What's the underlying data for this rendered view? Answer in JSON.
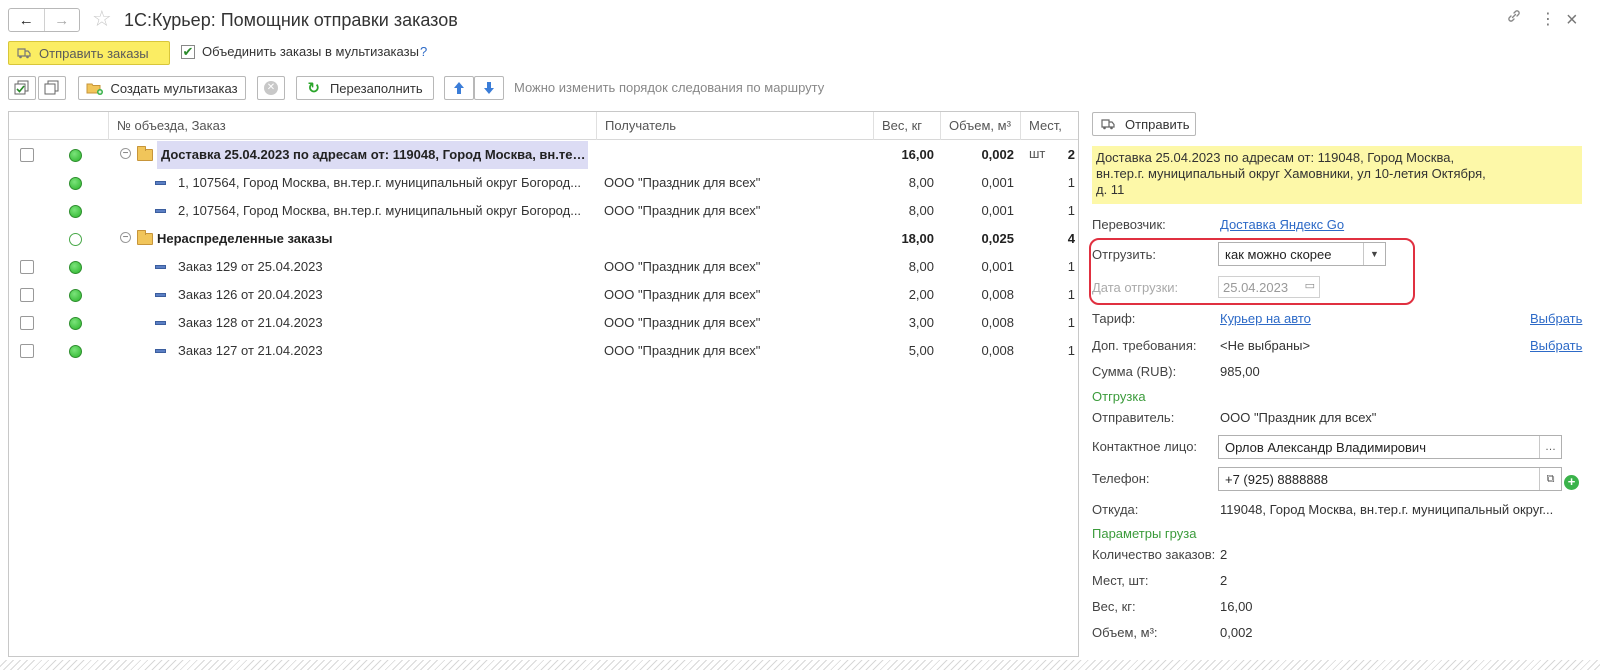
{
  "window": {
    "title": "1С:Курьер: Помощник отправки заказов",
    "back_glyph": "←",
    "forward_glyph": "→",
    "star_glyph": "☆",
    "link_glyph": "🔗",
    "menu_glyph": "⋮",
    "close_glyph": "×"
  },
  "toolbar1": {
    "send_orders_label": "Отправить заказы",
    "merge_checkbox_label": "Объединить заказы в мультизаказы",
    "merge_checked": true,
    "help": "?"
  },
  "toolbar2": {
    "create_multiorder_label": "Создать мультизаказ",
    "refill_label": "Перезаполнить",
    "hint": "Можно изменить порядок следования по маршруту"
  },
  "table": {
    "columns": [
      "№ объезда, Заказ",
      "Получатель",
      "Вес, кг",
      "Объем, м³",
      "Мест, шт"
    ],
    "rows": [
      {
        "kind": "group",
        "checkbox": true,
        "status": "filled",
        "name": "Доставка 25.04.2023 по адресам от: 119048, Город Москва, вн.тер...",
        "recipient": "",
        "weight": "16,00",
        "volume": "0,002",
        "places": "2",
        "selected": true
      },
      {
        "kind": "item",
        "checkbox": false,
        "status": "filled",
        "name": "1, 107564, Город Москва, вн.тер.г. муниципальный округ Богород...",
        "recipient": "ООО \"Праздник для всех\"",
        "weight": "8,00",
        "volume": "0,001",
        "places": "1"
      },
      {
        "kind": "item",
        "checkbox": false,
        "status": "filled",
        "name": "2, 107564, Город Москва, вн.тер.г. муниципальный округ Богород...",
        "recipient": "ООО \"Праздник для всех\"",
        "weight": "8,00",
        "volume": "0,001",
        "places": "1"
      },
      {
        "kind": "group",
        "checkbox": false,
        "status": "hollow",
        "name": "Нераспределенные заказы",
        "recipient": "",
        "weight": "18,00",
        "volume": "0,025",
        "places": "4"
      },
      {
        "kind": "item",
        "checkbox": true,
        "status": "filled",
        "name": "Заказ 129 от 25.04.2023",
        "recipient": "ООО \"Праздник для всех\"",
        "weight": "8,00",
        "volume": "0,001",
        "places": "1"
      },
      {
        "kind": "item",
        "checkbox": true,
        "status": "filled",
        "name": "Заказ 126 от 20.04.2023",
        "recipient": "ООО \"Праздник для всех\"",
        "weight": "2,00",
        "volume": "0,008",
        "places": "1"
      },
      {
        "kind": "item",
        "checkbox": true,
        "status": "filled",
        "name": "Заказ 128 от 21.04.2023",
        "recipient": "ООО \"Праздник для всех\"",
        "weight": "3,00",
        "volume": "0,008",
        "places": "1"
      },
      {
        "kind": "item",
        "checkbox": true,
        "status": "filled",
        "name": "Заказ 127 от 21.04.2023",
        "recipient": "ООО \"Праздник для всех\"",
        "weight": "5,00",
        "volume": "0,008",
        "places": "1"
      }
    ]
  },
  "panel": {
    "send_label": "Отправить",
    "note_lines": [
      "Доставка 25.04.2023 по адресам от: 119048, Город Москва,",
      "вн.тер.г. муниципальный округ Хамовники, ул 10-летия Октября,",
      "д. 11"
    ],
    "carrier_label": "Перевозчик:",
    "carrier_value": "Доставка Яндекс Go",
    "ship_label": "Отгрузить:",
    "ship_value": "как можно скорее",
    "ship_date_label": "Дата отгрузки:",
    "ship_date_value": "25.04.2023",
    "tariff_label": "Тариф:",
    "tariff_value": "Курьер на авто",
    "tariff_choose": "Выбрать",
    "extra_label": "Доп. требования:",
    "extra_value": "<Не выбраны>",
    "extra_choose": "Выбрать",
    "sum_label": "Сумма (RUB):",
    "sum_value": "985,00",
    "section_shipment": "Отгрузка",
    "sender_label": "Отправитель:",
    "sender_value": "ООО \"Праздник для всех\"",
    "contact_label": "Контактное лицо:",
    "contact_value": "Орлов Александр Владимирович",
    "phone_label": "Телефон:",
    "phone_value": "+7 (925) 8888888",
    "from_label": "Откуда:",
    "from_value": "119048, Город Москва, вн.тер.г. муниципальный округ...",
    "section_cargo": "Параметры груза",
    "orders_count_label": "Количество заказов:",
    "orders_count_value": "2",
    "places_label": "Мест, шт:",
    "places_value": "2",
    "weight_label": "Вес, кг:",
    "weight_value": "16,00",
    "volume_label": "Объем, м³:",
    "volume_value": "0,002"
  },
  "colors": {
    "accent_yellow": "#fbed63",
    "note_yellow": "#fdf8a8",
    "link_blue": "#2d6ac7",
    "section_green": "#3b9b3b",
    "highlight_red": "#e03040",
    "selected_row": "#dcdcf4"
  }
}
